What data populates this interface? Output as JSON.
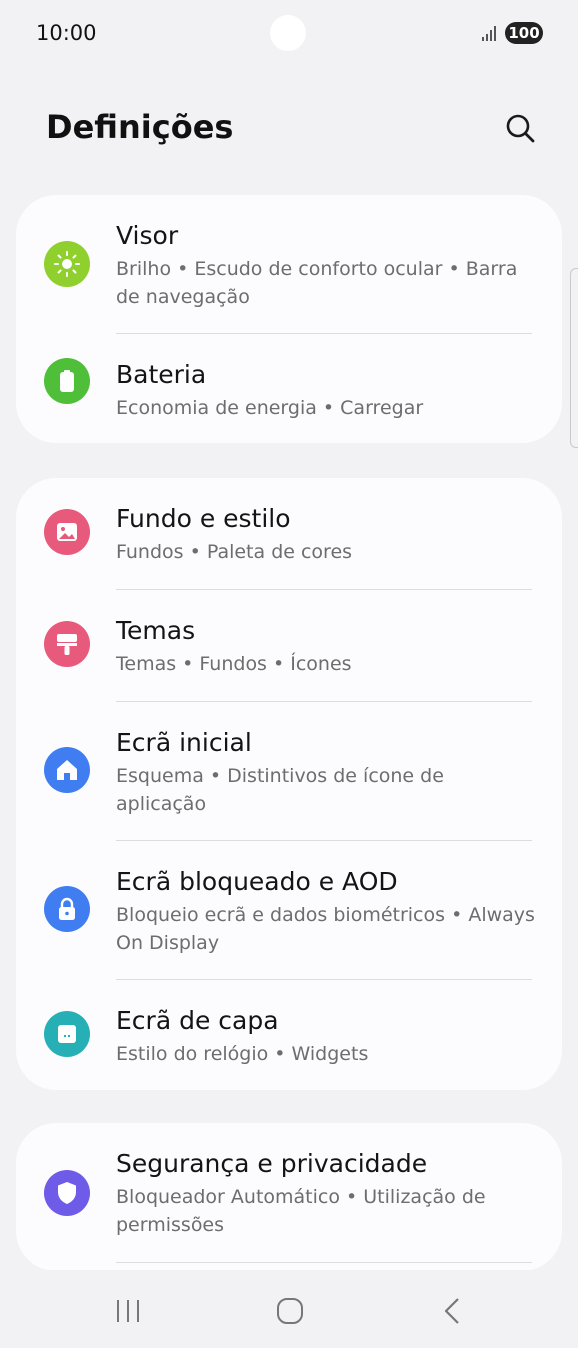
{
  "status": {
    "time": "10:00",
    "battery": "100"
  },
  "header": {
    "title": "Definições"
  },
  "cards": [
    {
      "items": [
        {
          "title": "Visor",
          "subtitle": "Brilho  •  Escudo de conforto ocular  •  Barra de navegação",
          "icon": "sun-icon",
          "color": "#8fcf2e"
        },
        {
          "title": "Bateria",
          "subtitle": "Economia de energia  •  Carregar",
          "icon": "battery-icon",
          "color": "#4fbf3a"
        }
      ]
    },
    {
      "items": [
        {
          "title": "Fundo e estilo",
          "subtitle": "Fundos  •  Paleta de cores",
          "icon": "image-icon",
          "color": "#e75a7c"
        },
        {
          "title": "Temas",
          "subtitle": "Temas  •  Fundos  •  Ícones",
          "icon": "paintbrush-icon",
          "color": "#e75a7c"
        },
        {
          "title": "Ecrã inicial",
          "subtitle": "Esquema  •  Distintivos de ícone de aplicação",
          "icon": "home-icon",
          "color": "#3f7df0"
        },
        {
          "title": "Ecrã bloqueado e AOD",
          "subtitle": "Bloqueio ecrã e dados biométricos  •  Always On Display",
          "icon": "lock-icon",
          "color": "#3f7df0"
        },
        {
          "title": "Ecrã de capa",
          "subtitle": "Estilo do relógio  •  Widgets",
          "icon": "cover-screen-icon",
          "color": "#26b0b6"
        }
      ]
    },
    {
      "items": [
        {
          "title": "Segurança e privacidade",
          "subtitle": "Bloqueador Automático  •  Utilização de permissões",
          "icon": "shield-icon",
          "color": "#6e5be8"
        }
      ]
    }
  ]
}
